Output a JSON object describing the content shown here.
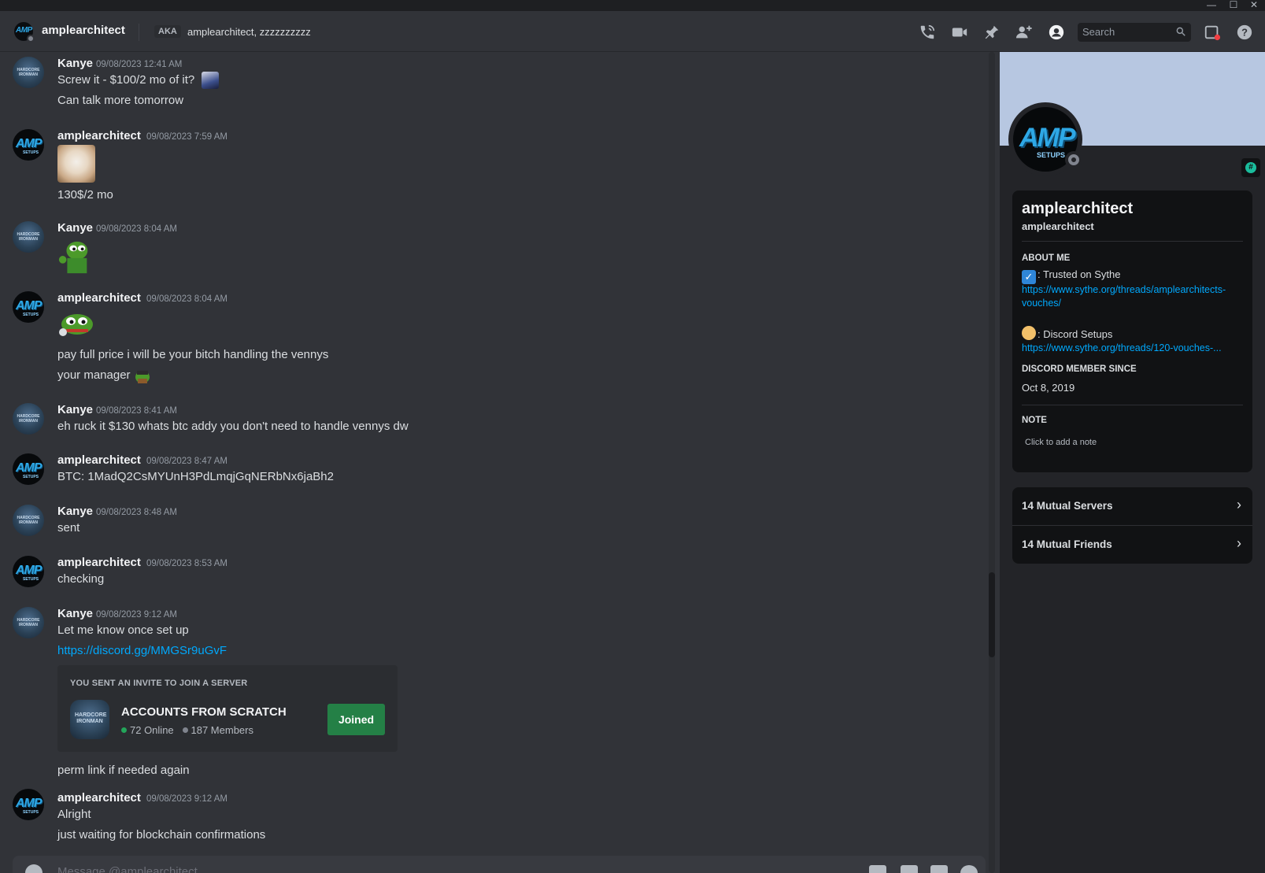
{
  "window": {
    "minimize": "—",
    "maximize": "☐",
    "close": "✕"
  },
  "header": {
    "title": "amplearchitect",
    "aka_badge": "AKA",
    "aka_names": "amplearchitect, zzzzzzzzzz",
    "search_placeholder": "Search"
  },
  "messages": [
    {
      "author": "Kanye",
      "time": "09/08/2023 12:41 AM",
      "lines": [
        "Screw it - $100/2 mo of it?",
        "Can talk more tomorrow"
      ]
    },
    {
      "author": "amplearchitect",
      "time": "09/08/2023 7:59 AM",
      "lines": [
        "130$/2 mo"
      ]
    },
    {
      "author": "Kanye",
      "time": "09/08/2023 8:04 AM",
      "lines": []
    },
    {
      "author": "amplearchitect",
      "time": "09/08/2023 8:04 AM",
      "lines": [
        "pay full price i will be your bitch handling the vennys",
        "your manager"
      ]
    },
    {
      "author": "Kanye",
      "time": "09/08/2023 8:41 AM",
      "lines": [
        "eh ruck it $130 whats btc addy you don't need to handle vennys dw"
      ]
    },
    {
      "author": "amplearchitect",
      "time": "09/08/2023 8:47 AM",
      "lines": [
        "BTC: 1MadQ2CsMYUnH3PdLmqjGqNERbNx6jaBh2"
      ]
    },
    {
      "author": "Kanye",
      "time": "09/08/2023 8:48 AM",
      "lines": [
        "sent"
      ]
    },
    {
      "author": "amplearchitect",
      "time": "09/08/2023 8:53 AM",
      "lines": [
        "checking"
      ]
    },
    {
      "author": "Kanye",
      "time": "09/08/2023 9:12 AM",
      "lines": [
        "Let me know once set up",
        "https://discord.gg/MMGSr9uGvF",
        "perm link if needed again"
      ]
    },
    {
      "author": "amplearchitect",
      "time": "09/08/2023 9:12 AM",
      "lines": [
        "Alright",
        "just waiting for blockchain confirmations"
      ]
    }
  ],
  "invite": {
    "caption": "YOU SENT AN INVITE TO JOIN A SERVER",
    "server_name": "ACCOUNTS FROM SCRATCH",
    "online": "72 Online",
    "members": "187 Members",
    "button": "Joined",
    "icon_text": "HARDCORE IRONMAN"
  },
  "avatar_text": {
    "amp": "AMP",
    "amp_sub": "SETUPS",
    "kanye": "HARDCORE IRONMAN"
  },
  "composer": {
    "placeholder": "Message @amplearchitect"
  },
  "profile": {
    "display_name": "amplearchitect",
    "username": "amplearchitect",
    "about_heading": "ABOUT ME",
    "about_1": ": Trusted on Sythe",
    "about_1_link": "https://www.sythe.org/threads/amplearchitects-vouches/",
    "about_2": ": Discord Setups",
    "about_2_link": "https://www.sythe.org/threads/120-vouches-...",
    "member_since_heading": "DISCORD MEMBER SINCE",
    "member_since": "Oct 8, 2019",
    "note_heading": "NOTE",
    "note_placeholder": "Click to add a note",
    "mutual_servers": "14 Mutual Servers",
    "mutual_friends": "14 Mutual Friends",
    "badge_symbol": "#"
  },
  "colors": {
    "background": "#313338",
    "panel": "#232428",
    "banner": "#b7c7e1",
    "link": "#00a8fc",
    "joined_button": "#248046",
    "online_dot": "#23a55a",
    "offline_dot": "#80848e"
  },
  "icons": [
    "phone-call-icon",
    "video-call-icon",
    "pin-icon",
    "add-friend-icon",
    "user-profile-icon",
    "search-icon",
    "inbox-icon",
    "help-icon",
    "gift-icon",
    "gif-icon",
    "sticker-icon",
    "emoji-icon"
  ]
}
